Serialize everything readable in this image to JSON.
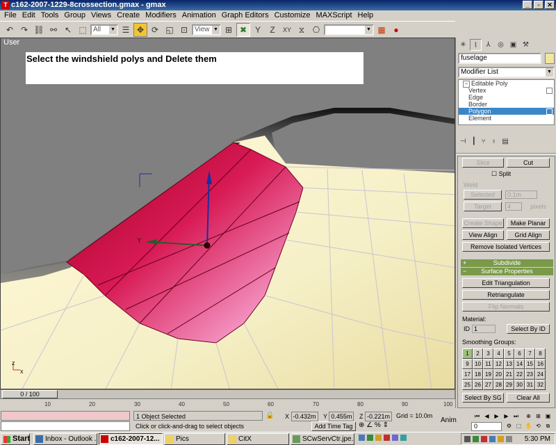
{
  "window": {
    "title": "c162-2007-1229-8crossection.gmax - gmax",
    "icon": "app-logo-icon",
    "min": "_",
    "max": "▫",
    "close": "✕"
  },
  "menu": [
    "File",
    "Edit",
    "Tools",
    "Group",
    "Views",
    "Create",
    "Modifiers",
    "Animation",
    "Graph Editors",
    "Customize",
    "MAXScript",
    "Help"
  ],
  "toolbar": {
    "selection_filter": "All",
    "ref_coord": "View"
  },
  "viewport": {
    "label": "User",
    "instruction": "Select the windshield polys and Delete them",
    "axis_y": "Y",
    "axis_z": "z",
    "axis_x": "x",
    "colors": {
      "background": "#808080",
      "surface": "#f6f0c8",
      "selected": "#c8103a"
    }
  },
  "command_panel": {
    "object_name": "fuselage",
    "modifier_list": "Modifier List",
    "stack": [
      {
        "label": "Editable Poly",
        "root": true
      },
      {
        "label": "Vertex"
      },
      {
        "label": "Edge"
      },
      {
        "label": "Border"
      },
      {
        "label": "Polygon",
        "selected": true
      },
      {
        "label": "Element"
      }
    ],
    "slice": "Slice",
    "cut": "Cut",
    "split": "Split",
    "weld": "Weld",
    "selected": "Selected",
    "weld_value": "0.1m",
    "target": "Target",
    "target_value": "4",
    "pixels": "pixels",
    "create_shape": "Create Shape",
    "make_planar": "Make Planar",
    "view_align": "View Align",
    "grid_align": "Grid Align",
    "remove_isolated": "Remove Isolated Vertices",
    "subdivide": "Subdivide",
    "surface_props": "Surface Properties",
    "edit_tri": "Edit Triangulation",
    "retriangulate": "Retriangulate",
    "flip_normals": "Flip Normals",
    "material": "Material:",
    "id_label": "ID",
    "id_value": "1",
    "select_by_id": "Select By ID",
    "smoothing_groups": "Smoothing Groups:",
    "sg_numbers": [
      "1",
      "2",
      "3",
      "4",
      "5",
      "6",
      "7",
      "8",
      "9",
      "10",
      "11",
      "12",
      "13",
      "14",
      "15",
      "16",
      "17",
      "18",
      "19",
      "20",
      "21",
      "22",
      "23",
      "24",
      "25",
      "26",
      "27",
      "28",
      "29",
      "30",
      "31",
      "32"
    ],
    "select_by_sg": "Select By SG",
    "clear_all": "Clear All"
  },
  "timeline": {
    "frame": "0 / 100",
    "ticks": [
      "10",
      "20",
      "30",
      "40",
      "50",
      "60",
      "70",
      "80",
      "90",
      "100"
    ]
  },
  "status": {
    "selected": "1 Object Selected",
    "prompt": "Click or click-and-drag to select objects",
    "x_label": "X",
    "x_value": "-0.432m",
    "y_label": "Y",
    "y_value": "0.455m",
    "z_label": "Z",
    "z_value": "-0.221m",
    "grid": "Grid = 10.0m",
    "add_time_tag": "Add Time Tag",
    "anim": "Anim",
    "frame_field": "0"
  },
  "taskbar": {
    "start": "Start",
    "tasks": [
      {
        "label": "Inbox - Outlook ...",
        "icon": "outlook-icon"
      },
      {
        "label": "c162-2007-12...",
        "icon": "gmax-icon",
        "active": true
      },
      {
        "label": "Pics",
        "icon": "folder-icon"
      },
      {
        "label": "CitX",
        "icon": "folder-icon"
      },
      {
        "label": "SCwServCtr.jpe...",
        "icon": "image-icon"
      }
    ],
    "clock": "5:30 PM"
  }
}
